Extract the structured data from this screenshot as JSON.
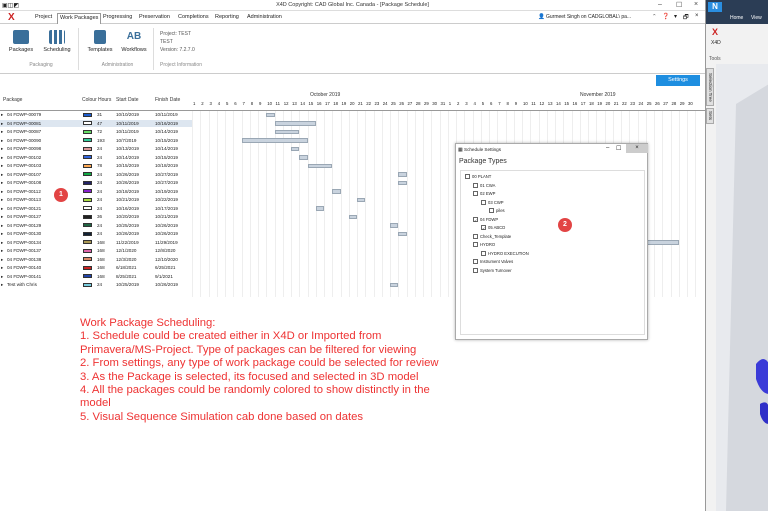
{
  "window": {
    "title": "X4D Copyright: CAD Global Inc. Canada - [Package Schedule]"
  },
  "menu": {
    "items": [
      "Project",
      "Work Packages",
      "Progressing",
      "Preservation",
      "Completions",
      "Reporting",
      "Administration"
    ],
    "user": "Gurmeet Singh on CADGLOBAL\\ pa..."
  },
  "ribbon": {
    "packages": "Packages",
    "scheduling": "Scheduling",
    "group_packaging": "Packaging",
    "templates": "Templates",
    "workflows": "Workflows",
    "group_admin": "Administration",
    "project_line1": "Project: TEST",
    "project_line2": "TEST",
    "project_line3": "Version: 7.2.7.0",
    "group_project": "Project Information"
  },
  "settings_button": "Settings",
  "table": {
    "columns": {
      "package": "Package",
      "colour": "Colour",
      "hours": "Hours",
      "start": "Start Date",
      "finish": "Finish Date"
    },
    "month1": "October 2019",
    "month2": "November 2019",
    "rows": [
      {
        "name": "04 FDWP-00079",
        "color": "#1f5fd0",
        "hours": "31",
        "start": "10/10/2019",
        "finish": "10/11/2019"
      },
      {
        "name": "04 FDWP-00081",
        "color": "#ffffff",
        "hours": "47",
        "start": "10/11/2019",
        "finish": "10/16/2019"
      },
      {
        "name": "04 FDWP-00087",
        "color": "#66dd66",
        "hours": "72",
        "start": "10/11/2019",
        "finish": "10/14/2019"
      },
      {
        "name": "04 FDWP-00090",
        "color": "#33cc99",
        "hours": "193",
        "start": "10/7/2019",
        "finish": "10/15/2019"
      },
      {
        "name": "04 FDWP-00098",
        "color": "#dd9999",
        "hours": "24",
        "start": "10/13/2019",
        "finish": "10/14/2019"
      },
      {
        "name": "04 FDWP-00102",
        "color": "#3366dd",
        "hours": "24",
        "start": "10/14/2019",
        "finish": "10/15/2019"
      },
      {
        "name": "04 FDWP-00103",
        "color": "#ffaa55",
        "hours": "78",
        "start": "10/15/2019",
        "finish": "10/18/2019"
      },
      {
        "name": "04 FDWP-00107",
        "color": "#11aa44",
        "hours": "24",
        "start": "10/26/2019",
        "finish": "10/27/2019"
      },
      {
        "name": "04 FDWP-00108",
        "color": "#222266",
        "hours": "24",
        "start": "10/26/2019",
        "finish": "10/27/2019"
      },
      {
        "name": "04 FDWP-00112",
        "color": "#8822cc",
        "hours": "24",
        "start": "10/18/2019",
        "finish": "10/19/2019"
      },
      {
        "name": "04 FDWP-00113",
        "color": "#aadd44",
        "hours": "24",
        "start": "10/21/2019",
        "finish": "10/22/2019"
      },
      {
        "name": "04 FDWP-00121",
        "color": "#ffffff",
        "hours": "24",
        "start": "10/16/2019",
        "finish": "10/17/2019"
      },
      {
        "name": "04 FDWP-00127",
        "color": "#222222",
        "hours": "36",
        "start": "10/20/2019",
        "finish": "10/21/2019"
      },
      {
        "name": "04 FDWP-00129",
        "color": "#226644",
        "hours": "24",
        "start": "10/25/2019",
        "finish": "10/26/2019"
      },
      {
        "name": "04 FDWP-00130",
        "color": "#112233",
        "hours": "24",
        "start": "10/26/2019",
        "finish": "10/26/2019"
      },
      {
        "name": "04 FDWP-00134",
        "color": "#aa9955",
        "hours": "168",
        "start": "11/22/2019",
        "finish": "11/29/2019"
      },
      {
        "name": "04 FDWP-00137",
        "color": "#dd66aa",
        "hours": "168",
        "start": "12/1/2020",
        "finish": "12/8/2020"
      },
      {
        "name": "04 FDWP-00138",
        "color": "#dd8866",
        "hours": "168",
        "start": "12/3/2020",
        "finish": "12/10/2020"
      },
      {
        "name": "04 FDWP-00140",
        "color": "#cc2222",
        "hours": "168",
        "start": "6/18/2021",
        "finish": "6/25/2021"
      },
      {
        "name": "04 FDWP-00141",
        "color": "#2244aa",
        "hours": "168",
        "start": "8/25/2021",
        "finish": "9/1/2021"
      },
      {
        "name": "Test with Chris",
        "color": "#77ccdd",
        "hours": "24",
        "start": "10/25/2019",
        "finish": "10/26/2019"
      }
    ]
  },
  "dialog": {
    "title": "Schedule Settings",
    "heading": "Package Types",
    "nodes": [
      {
        "label": "00 PLANT",
        "depth": 0,
        "checked": false
      },
      {
        "label": "01 CWA",
        "depth": 1,
        "checked": false
      },
      {
        "label": "02 EWP",
        "depth": 1,
        "checked": false
      },
      {
        "label": "03 CWP",
        "depth": 2,
        "checked": false
      },
      {
        "label": "piles",
        "depth": 3,
        "checked": false
      },
      {
        "label": "04 FDWP",
        "depth": 1,
        "checked": true
      },
      {
        "label": "05 ABCD",
        "depth": 2,
        "checked": true
      },
      {
        "label": "Check_Template",
        "depth": 1,
        "checked": false
      },
      {
        "label": "HYDRO",
        "depth": 1,
        "checked": false
      },
      {
        "label": "HYDRO EXECUTION",
        "depth": 2,
        "checked": false
      },
      {
        "label": "Instrument Valves",
        "depth": 1,
        "checked": false
      },
      {
        "label": "System Turnover",
        "depth": 1,
        "checked": false
      }
    ]
  },
  "badges": {
    "one": "1",
    "two": "2"
  },
  "notes": [
    "Work Package Scheduling:",
    "1. Schedule could be created either in X4D or Imported from",
    "Primavera/MS-Project. Type of packages can be filtered for viewing",
    "2. From settings, any type of work package could be selected for review",
    "3. As the Package is selected, its focused and selected in 3D model",
    "4. All the packages could be randomly colored to show distinctly in the",
    "model",
    "5. Visual Sequence Simulation cab done based on dates"
  ],
  "right_app": {
    "home": "Home",
    "view": "View",
    "app": "X4D",
    "tools": "Tools",
    "tab1": "Selection Tree",
    "tab2": "Sets"
  }
}
